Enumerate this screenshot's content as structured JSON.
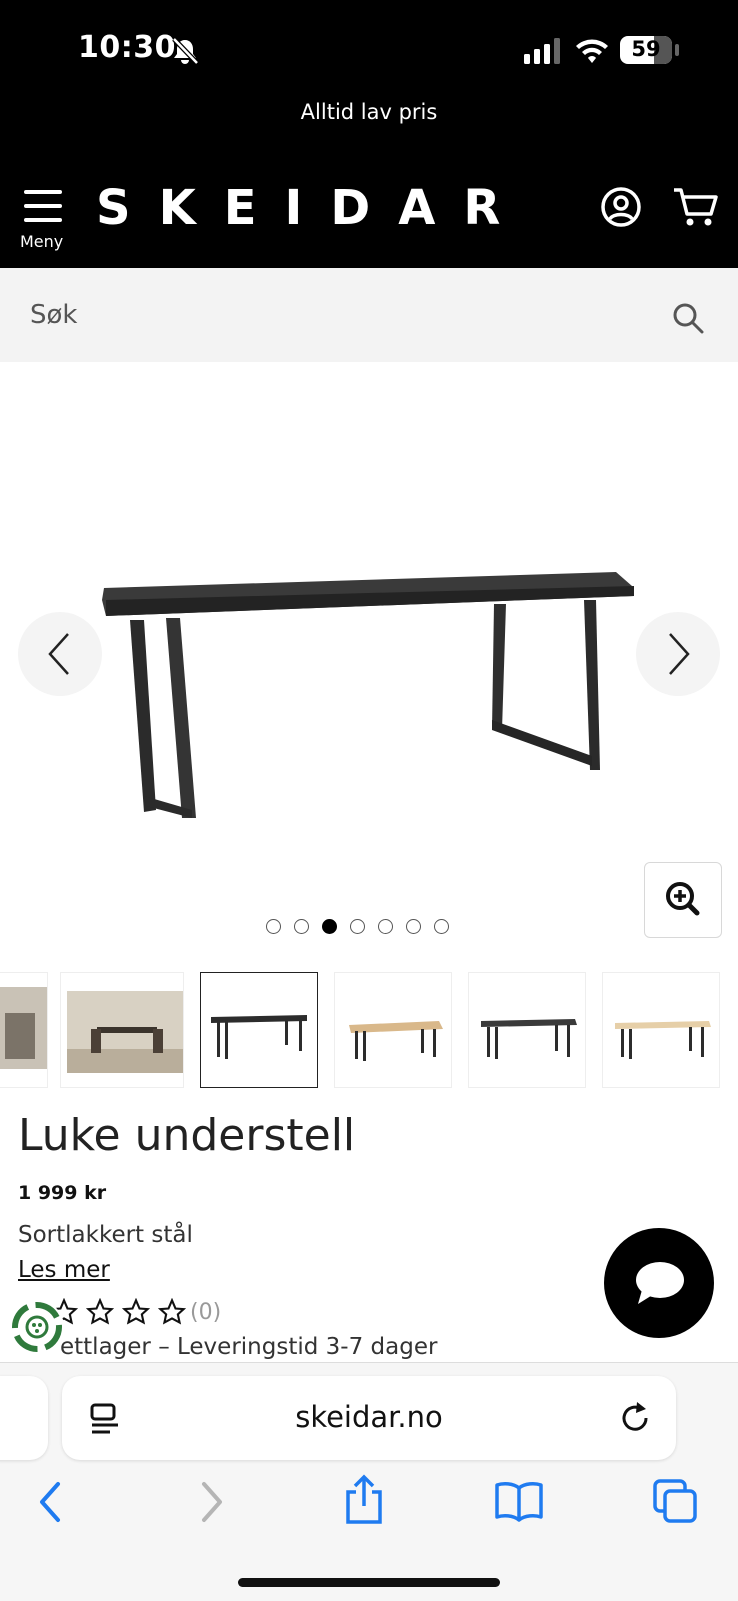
{
  "status": {
    "time": "10:30",
    "battery": "59"
  },
  "header": {
    "promo": "Alltid lav pris",
    "brand": "SKEIDAR",
    "menu_label": "Meny"
  },
  "search": {
    "placeholder": "Søk"
  },
  "carousel": {
    "image_count": 7,
    "active_index": 2,
    "thumbnail_count": 6
  },
  "product": {
    "title": "Luke understell",
    "price": "1 999 kr",
    "material": "Sortlakkert stål",
    "read_more": "Les mer",
    "rating_count": "(0)",
    "rating": 0,
    "stock": "ettlager – Leveringstid 3-7 dager"
  },
  "browser": {
    "url": "skeidar.no"
  },
  "icons": [
    "bell-slash-icon",
    "signal-icon",
    "wifi-icon",
    "battery-icon",
    "hamburger-icon",
    "account-icon",
    "cart-icon",
    "search-icon",
    "chevron-left-icon",
    "chevron-right-icon",
    "zoom-in-icon",
    "chat-icon",
    "recycle-badge-icon",
    "reader-icon",
    "reload-icon",
    "back-icon",
    "forward-icon",
    "share-icon",
    "bookmarks-icon",
    "tabs-icon"
  ],
  "colors": {
    "header_bg": "#000000",
    "search_bg": "#f3f3f3",
    "link_blue": "#1f7bf0"
  }
}
